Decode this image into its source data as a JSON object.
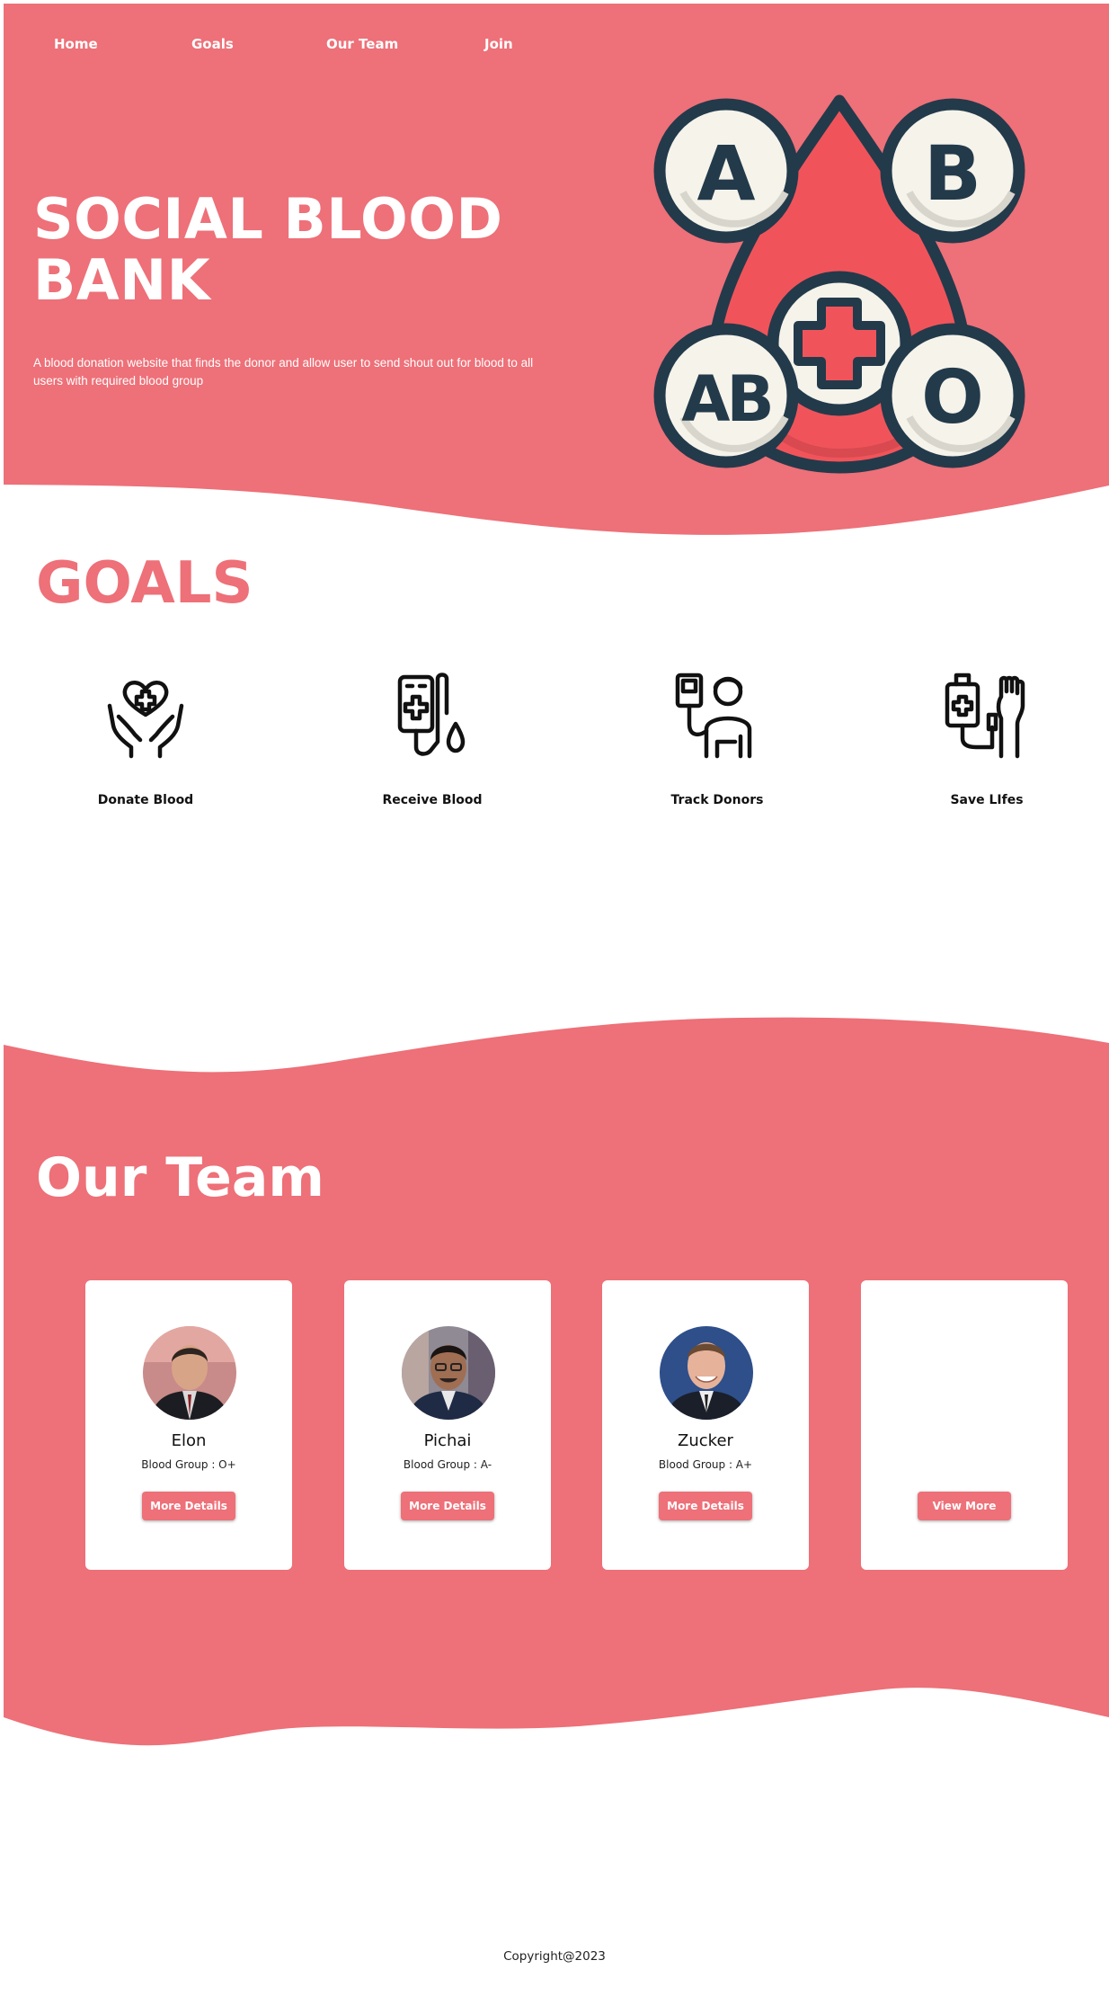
{
  "nav": {
    "items": [
      {
        "label": "Home"
      },
      {
        "label": "Goals"
      },
      {
        "label": "Our Team"
      },
      {
        "label": "Join"
      }
    ]
  },
  "hero": {
    "title_line1": "SOCIAL BLOOD",
    "title_line2": "BANK",
    "description": "A blood donation website that finds the donor and allow user to send shout out for blood to all users with required blood group",
    "blood_types": [
      "A",
      "B",
      "AB",
      "O"
    ]
  },
  "goals": {
    "title": "GOALS",
    "items": [
      {
        "label": "Donate Blood",
        "icon": "hands-heart-icon"
      },
      {
        "label": "Receive Blood",
        "icon": "blood-bag-icon"
      },
      {
        "label": "Track Donors",
        "icon": "donor-icon"
      },
      {
        "label": "Save LIfes",
        "icon": "transfusion-icon"
      }
    ]
  },
  "team": {
    "title": "Our Team",
    "members": [
      {
        "name": "Elon",
        "blood": "Blood Group : O+",
        "button": "More Details"
      },
      {
        "name": "Pichai",
        "blood": "Blood Group : A-",
        "button": "More Details"
      },
      {
        "name": "Zucker",
        "blood": "Blood Group : A+",
        "button": "More Details"
      }
    ],
    "view_more": "View More"
  },
  "footer": {
    "text": "Copyright@2023"
  },
  "colors": {
    "accent": "#ee7078",
    "dark": "#233a4b",
    "cream": "#f5f3ea",
    "drop": "#f0545a"
  }
}
